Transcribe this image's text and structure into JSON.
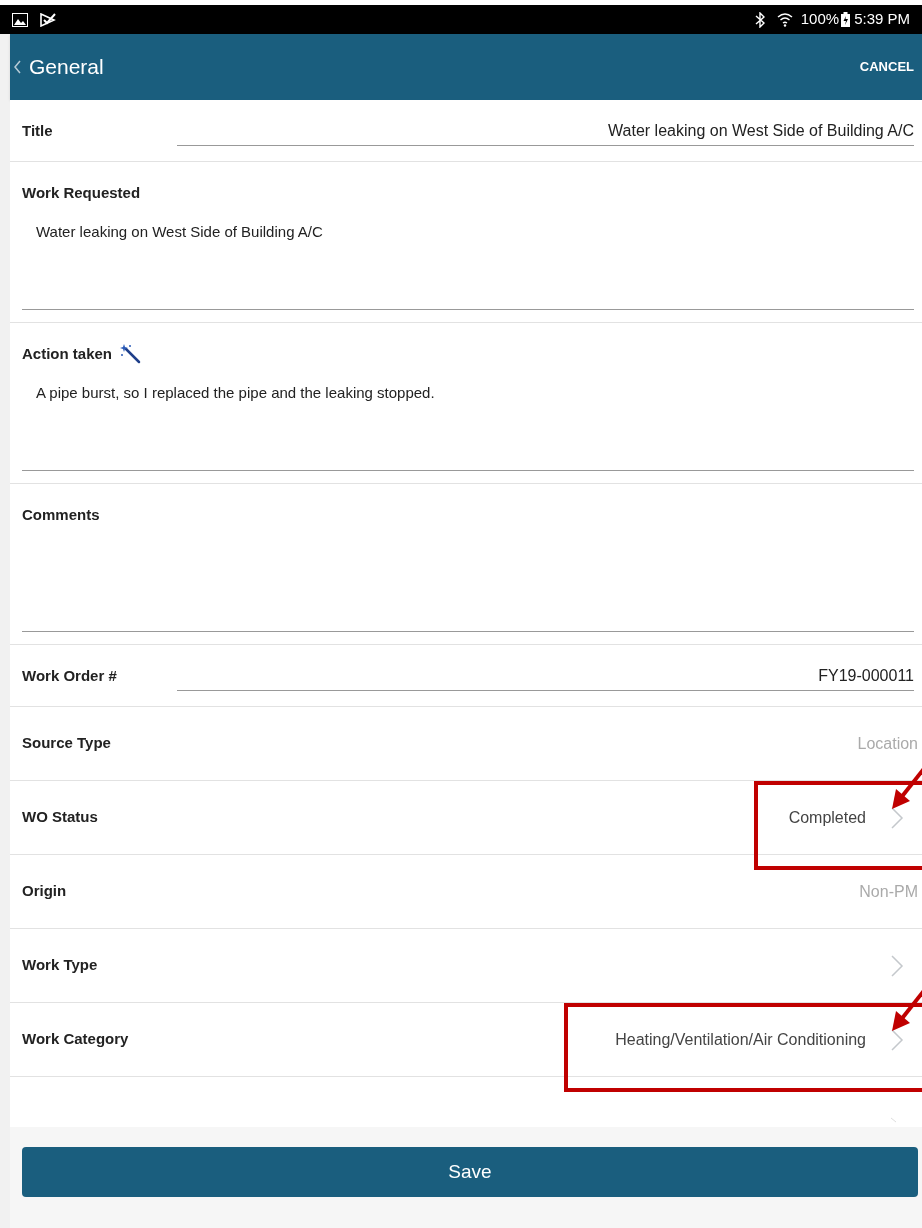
{
  "status_bar": {
    "battery": "100%",
    "time": "5:39 PM"
  },
  "app_bar": {
    "back_label": "General",
    "action": "CANCEL"
  },
  "rows": [
    {
      "kind": "field",
      "label": "Title",
      "value": "Water leaking on West Side of Building A/C"
    },
    {
      "kind": "textarea",
      "label": "Work Requested",
      "value": "Water leaking on West Side of Building A/C"
    },
    {
      "kind": "textarea",
      "label": "Action taken",
      "value": "A pipe burst, so I replaced the pipe and the leaking stopped.",
      "wand": true
    },
    {
      "kind": "textarea",
      "label": "Comments"
    },
    {
      "kind": "field",
      "label": "Work Order #",
      "value": "FY19-000011"
    },
    {
      "kind": "readonly",
      "label": "Source Type",
      "value": "Location"
    },
    {
      "kind": "picker",
      "label": "WO Status",
      "value": "Completed",
      "highlighted": true
    },
    {
      "kind": "readonly",
      "label": "Origin",
      "value": "Non-PM"
    },
    {
      "kind": "picker",
      "label": "Work Type",
      "highlighted": false
    },
    {
      "kind": "picker",
      "label": "Work Category",
      "value": "Heating/Ventilation/Air Conditioning",
      "highlighted": true
    }
  ],
  "save_button": "Save"
}
